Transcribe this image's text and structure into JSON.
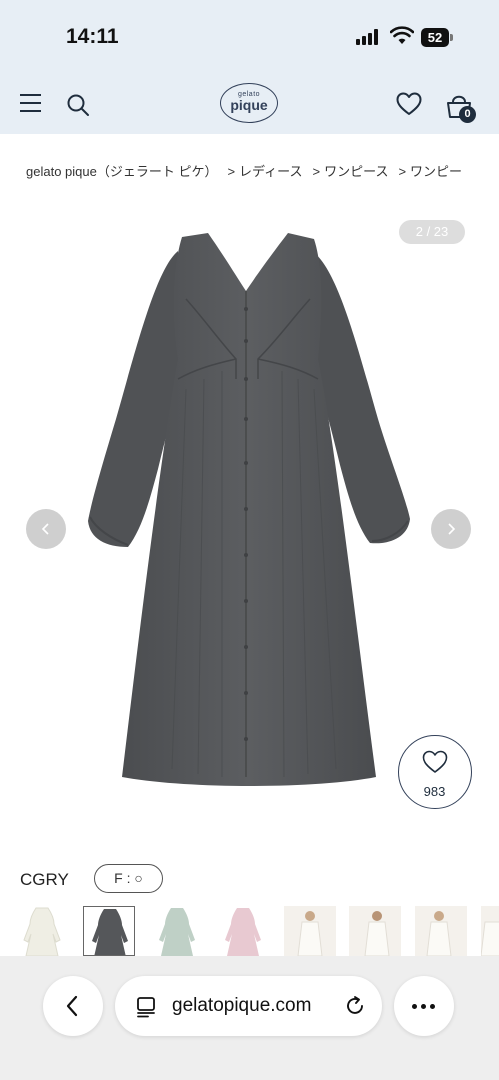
{
  "status_bar": {
    "time": "14:11",
    "battery": "52"
  },
  "header": {
    "logo_small": "gelato",
    "logo_main": "pique",
    "cart_count": "0"
  },
  "breadcrumb": {
    "items": [
      "gelato pique（ジェラート ピケ）",
      "レディース",
      "ワンピース",
      "ワンピー"
    ],
    "separator": ">"
  },
  "gallery": {
    "counter": "2 / 23",
    "like_count": "983",
    "dress_color": "#555759"
  },
  "product": {
    "color_name": "CGRY",
    "size_label": "F : ○"
  },
  "thumbnails": [
    {
      "kind": "dress",
      "color": "#f1f0e6",
      "selected": false
    },
    {
      "kind": "dress",
      "color": "#55575a",
      "selected": true
    },
    {
      "kind": "dress",
      "color": "#bfd0c6",
      "selected": false
    },
    {
      "kind": "dress",
      "color": "#e8c9d1",
      "selected": false
    },
    {
      "kind": "model",
      "color": "#f4f1ec",
      "selected": false
    },
    {
      "kind": "model",
      "color": "#f4f1ec",
      "selected": false
    },
    {
      "kind": "model",
      "color": "#f4f1ec",
      "selected": false
    },
    {
      "kind": "model",
      "color": "#f4f1ec",
      "selected": false
    }
  ],
  "browser": {
    "url": "gelatopique.com"
  },
  "colors": {
    "header_bg": "#e7eef5",
    "brand_navy": "#33415a",
    "browser_bg": "#eeeeee"
  }
}
